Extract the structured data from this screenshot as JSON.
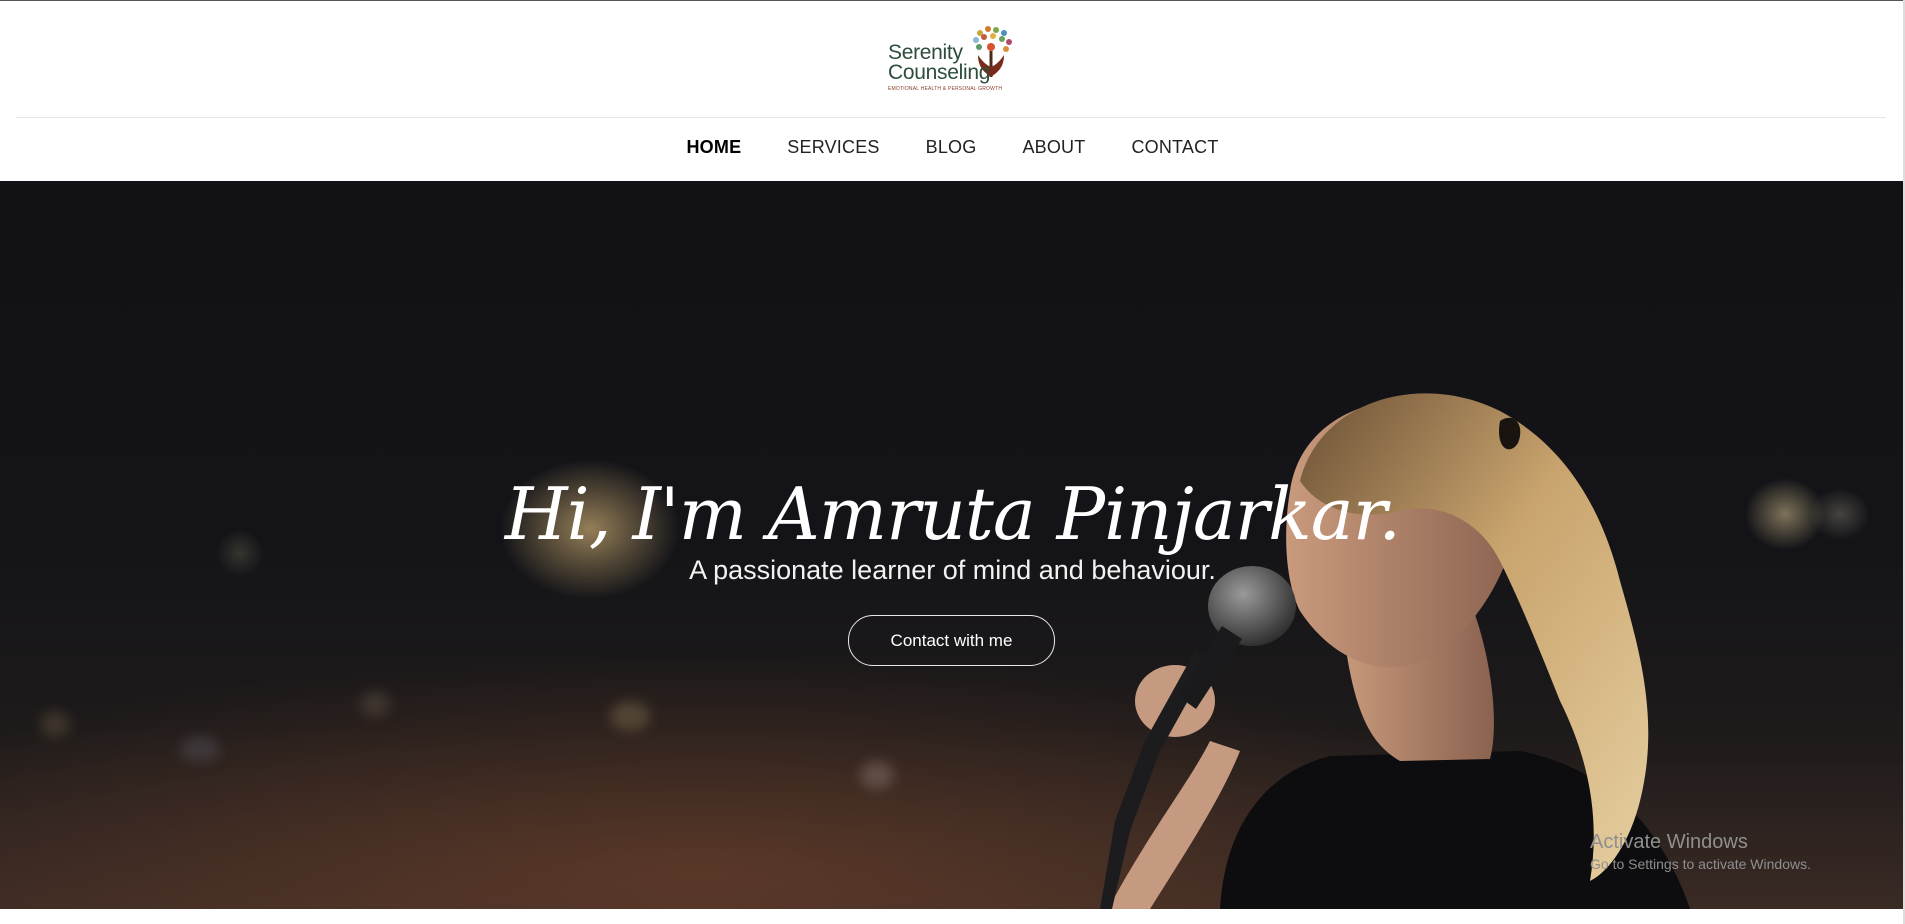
{
  "logo": {
    "line1": "Serenity",
    "line2": "Counseling",
    "tagline": "EMOTIONAL HEALTH & PERSONAL GROWTH"
  },
  "nav": {
    "items": [
      {
        "label": "HOME",
        "active": true
      },
      {
        "label": "SERVICES"
      },
      {
        "label": "BLOG"
      },
      {
        "label": "ABOUT"
      },
      {
        "label": "CONTACT"
      }
    ]
  },
  "hero": {
    "title": "Hi, I'm Amruta Pinjarkar.",
    "subtitle": "A passionate learner of mind and behaviour.",
    "button_label": "Contact with me"
  },
  "watermark": {
    "title": "Activate Windows",
    "subtitle": "Go to Settings to activate Windows."
  },
  "colors": {
    "logo_green": "#2d4d3a",
    "hero_bg": "#141418",
    "text_white": "#ffffff"
  }
}
